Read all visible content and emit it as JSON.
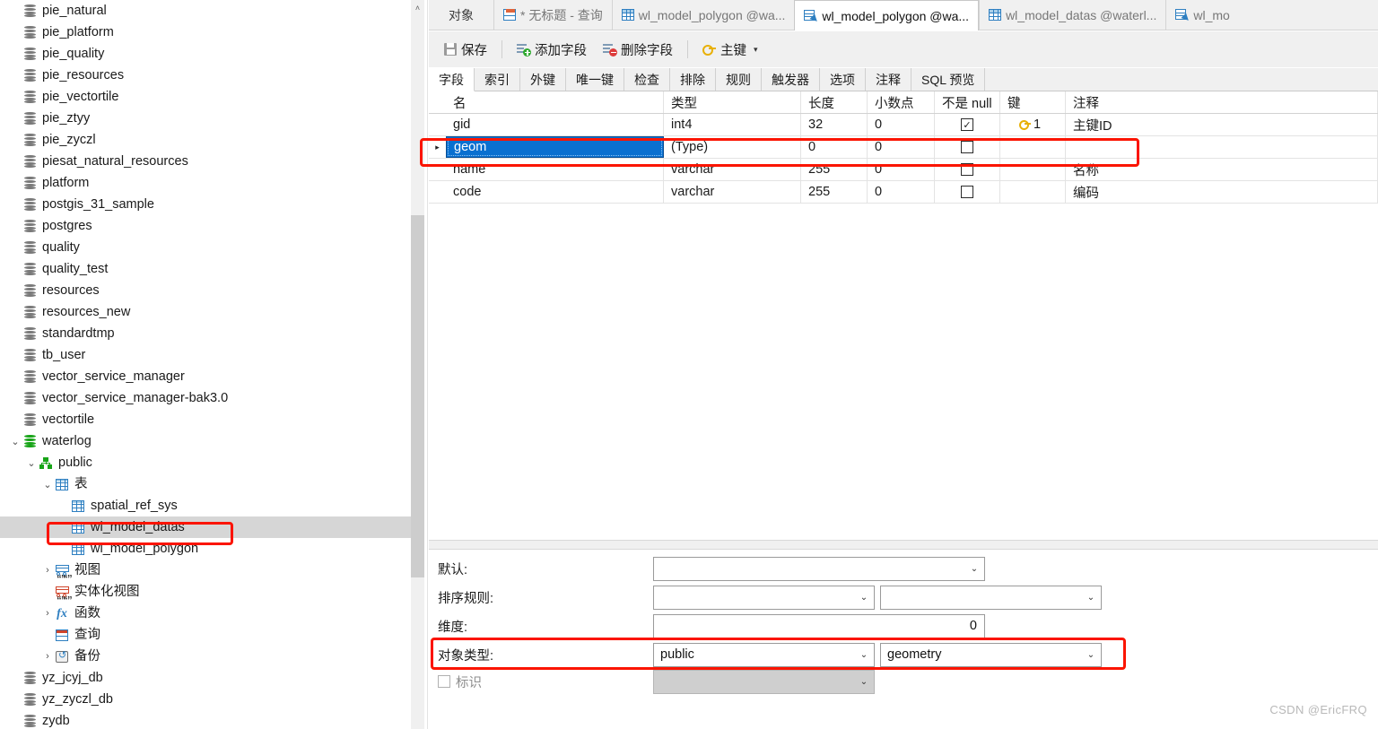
{
  "sidebar": {
    "scroll": {
      "arrow_up": "˄"
    },
    "items": [
      {
        "label": "pie_natural",
        "icon": "database-icon",
        "indent": 0,
        "twisty": "",
        "selected": false
      },
      {
        "label": "pie_platform",
        "icon": "database-icon",
        "indent": 0,
        "twisty": "",
        "selected": false
      },
      {
        "label": "pie_quality",
        "icon": "database-icon",
        "indent": 0,
        "twisty": "",
        "selected": false
      },
      {
        "label": "pie_resources",
        "icon": "database-icon",
        "indent": 0,
        "twisty": "",
        "selected": false
      },
      {
        "label": "pie_vectortile",
        "icon": "database-icon",
        "indent": 0,
        "twisty": "",
        "selected": false
      },
      {
        "label": "pie_ztyy",
        "icon": "database-icon",
        "indent": 0,
        "twisty": "",
        "selected": false
      },
      {
        "label": "pie_zyczl",
        "icon": "database-icon",
        "indent": 0,
        "twisty": "",
        "selected": false
      },
      {
        "label": "piesat_natural_resources",
        "icon": "database-icon",
        "indent": 0,
        "twisty": "",
        "selected": false
      },
      {
        "label": "platform",
        "icon": "database-icon",
        "indent": 0,
        "twisty": "",
        "selected": false
      },
      {
        "label": "postgis_31_sample",
        "icon": "database-icon",
        "indent": 0,
        "twisty": "",
        "selected": false
      },
      {
        "label": "postgres",
        "icon": "database-icon",
        "indent": 0,
        "twisty": "",
        "selected": false
      },
      {
        "label": "quality",
        "icon": "database-icon",
        "indent": 0,
        "twisty": "",
        "selected": false
      },
      {
        "label": "quality_test",
        "icon": "database-icon",
        "indent": 0,
        "twisty": "",
        "selected": false
      },
      {
        "label": "resources",
        "icon": "database-icon",
        "indent": 0,
        "twisty": "",
        "selected": false
      },
      {
        "label": "resources_new",
        "icon": "database-icon",
        "indent": 0,
        "twisty": "",
        "selected": false
      },
      {
        "label": "standardtmp",
        "icon": "database-icon",
        "indent": 0,
        "twisty": "",
        "selected": false
      },
      {
        "label": "tb_user",
        "icon": "database-icon",
        "indent": 0,
        "twisty": "",
        "selected": false
      },
      {
        "label": "vector_service_manager",
        "icon": "database-icon",
        "indent": 0,
        "twisty": "",
        "selected": false
      },
      {
        "label": "vector_service_manager-bak3.0",
        "icon": "database-icon",
        "indent": 0,
        "twisty": "",
        "selected": false
      },
      {
        "label": "vectortile",
        "icon": "database-icon",
        "indent": 0,
        "twisty": "",
        "selected": false
      },
      {
        "label": "waterlog",
        "icon": "database-icon-green",
        "indent": 0,
        "twisty": "⌄",
        "selected": false
      },
      {
        "label": "public",
        "icon": "schema-icon",
        "indent": 1,
        "twisty": "⌄",
        "selected": false
      },
      {
        "label": "表",
        "icon": "table-icon",
        "indent": 2,
        "twisty": "⌄",
        "selected": false
      },
      {
        "label": "spatial_ref_sys",
        "icon": "table-icon",
        "indent": 3,
        "twisty": "",
        "selected": false
      },
      {
        "label": "wl_model_datas",
        "icon": "table-icon",
        "indent": 3,
        "twisty": "",
        "selected": true
      },
      {
        "label": "wl_model_polygon",
        "icon": "table-icon",
        "indent": 3,
        "twisty": "",
        "selected": false
      },
      {
        "label": "视图",
        "icon": "view-icon",
        "indent": 2,
        "twisty": "›",
        "selected": false
      },
      {
        "label": "实体化视图",
        "icon": "materialized-view-icon",
        "indent": 2,
        "twisty": "",
        "selected": false
      },
      {
        "label": "函数",
        "icon": "function-icon",
        "indent": 2,
        "twisty": "›",
        "selected": false
      },
      {
        "label": "查询",
        "icon": "query-icon",
        "indent": 2,
        "twisty": "",
        "selected": false
      },
      {
        "label": "备份",
        "icon": "backup-icon",
        "indent": 2,
        "twisty": "›",
        "selected": false
      },
      {
        "label": "yz_jcyj_db",
        "icon": "database-icon",
        "indent": 0,
        "twisty": "",
        "selected": false
      },
      {
        "label": "yz_zyczl_db",
        "icon": "database-icon",
        "indent": 0,
        "twisty": "",
        "selected": false
      },
      {
        "label": "zydb",
        "icon": "database-icon",
        "indent": 0,
        "twisty": "",
        "selected": false
      }
    ]
  },
  "tabbar": {
    "object_label": "对象",
    "tabs": [
      {
        "label": "* 无标题 - 查询",
        "icon": "query-doc-icon",
        "active": false
      },
      {
        "label": "wl_model_polygon @wa...",
        "icon": "table-icon",
        "active": false
      },
      {
        "label": "wl_model_polygon @wa...",
        "icon": "table-design-icon",
        "active": true
      },
      {
        "label": "wl_model_datas @waterl...",
        "icon": "table-icon",
        "active": false
      },
      {
        "label": "wl_mo",
        "icon": "table-design-icon",
        "active": false
      }
    ]
  },
  "toolbar": {
    "save_label": "保存",
    "add_field_label": "添加字段",
    "delete_field_label": "删除字段",
    "primary_key_label": "主键",
    "caret": "▾"
  },
  "subtabs": [
    {
      "label": "字段",
      "active": true
    },
    {
      "label": "索引",
      "active": false
    },
    {
      "label": "外键",
      "active": false
    },
    {
      "label": "唯一键",
      "active": false
    },
    {
      "label": "检查",
      "active": false
    },
    {
      "label": "排除",
      "active": false
    },
    {
      "label": "规则",
      "active": false
    },
    {
      "label": "触发器",
      "active": false
    },
    {
      "label": "选项",
      "active": false
    },
    {
      "label": "注释",
      "active": false
    },
    {
      "label": "SQL 预览",
      "active": false
    }
  ],
  "grid": {
    "columns": [
      "名",
      "类型",
      "长度",
      "小数点",
      "不是 null",
      "键",
      "注释"
    ],
    "rows": [
      {
        "marker": "",
        "name": "gid",
        "type": "int4",
        "length": "32",
        "decimals": "0",
        "not_null": true,
        "key": "1",
        "comment": "主键ID",
        "selected": false
      },
      {
        "marker": "▸",
        "name": "geom",
        "type": "(Type)",
        "length": "0",
        "decimals": "0",
        "not_null": false,
        "key": "",
        "comment": "",
        "selected": true
      },
      {
        "marker": "",
        "name": "name",
        "type": "varchar",
        "length": "255",
        "decimals": "0",
        "not_null": false,
        "key": "",
        "comment": "名称",
        "selected": false
      },
      {
        "marker": "",
        "name": "code",
        "type": "varchar",
        "length": "255",
        "decimals": "0",
        "not_null": false,
        "key": "",
        "comment": "编码",
        "selected": false
      }
    ],
    "checkmark": "✓"
  },
  "form": {
    "default_label": "默认:",
    "default_value": "",
    "collation_label": "排序规则:",
    "collation_value_1": "",
    "collation_value_2": "",
    "dimension_label": "维度:",
    "dimension_value": "0",
    "object_type_label": "对象类型:",
    "object_type_schema": "public",
    "object_type_type": "geometry",
    "identity_label": "标识",
    "identity_value": "",
    "chevron": "⌄"
  },
  "watermark": "CSDN @EricFRQ",
  "colors": {
    "selection_blue": "#0a70d0",
    "annotation_red": "#fb1400",
    "row_highlight_gray": "#d6d6d6",
    "toolbar_gray": "#f0f0f0"
  }
}
